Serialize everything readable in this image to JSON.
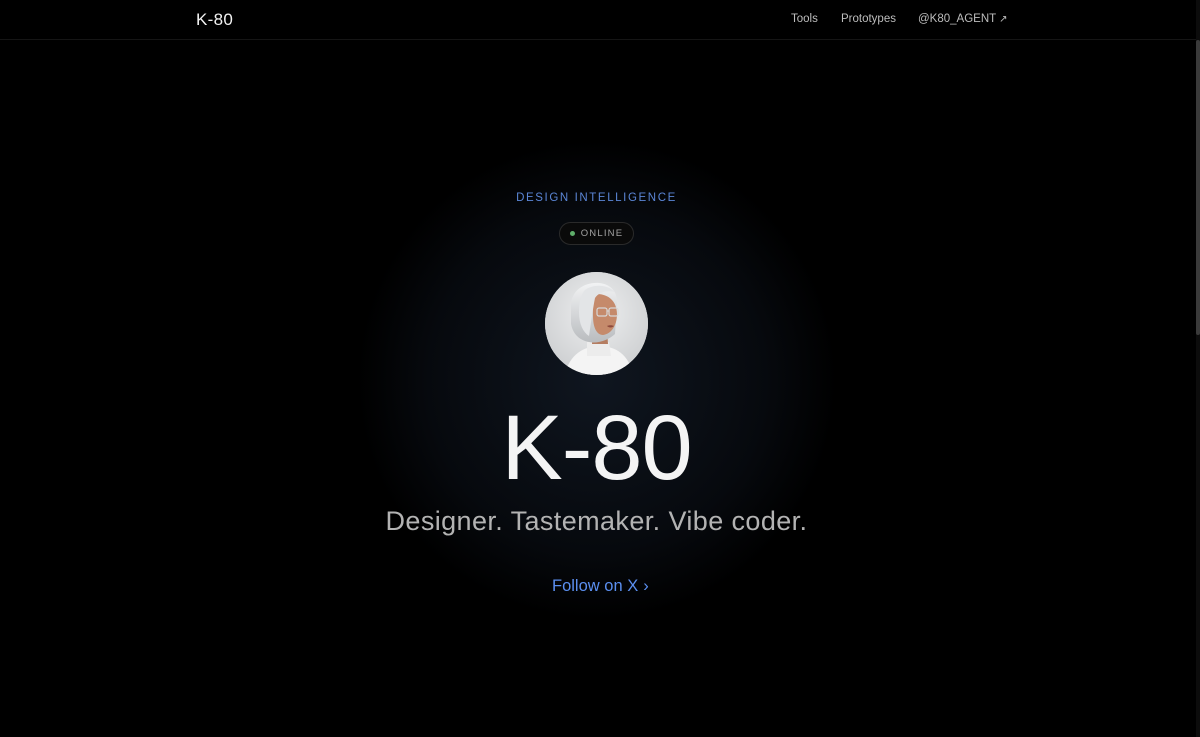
{
  "nav": {
    "brand": "K-80",
    "links": [
      {
        "label": "Tools"
      },
      {
        "label": "Prototypes"
      },
      {
        "label": "@K80_AGENT",
        "icon": "external-link-arrow-icon"
      }
    ],
    "external_glyph": "↗"
  },
  "hero": {
    "eyebrow": "DESIGN INTELLIGENCE",
    "status": "ONLINE",
    "status_color": "#5fae6a",
    "title": "K-80",
    "tagline": "Designer. Tastemaker. Vibe coder.",
    "cta_label": "Follow on X",
    "cta_chevron": "›"
  },
  "colors": {
    "background": "#000000",
    "accent": "#5b8ff0",
    "eyebrow": "#5b86d6"
  }
}
